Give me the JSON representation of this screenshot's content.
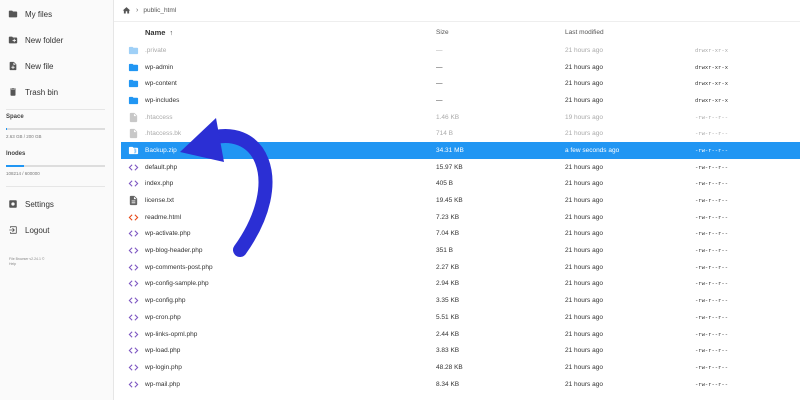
{
  "sidebar": {
    "items": [
      {
        "label": "My files",
        "icon": "folder-icon"
      },
      {
        "label": "New folder",
        "icon": "new-folder-icon"
      },
      {
        "label": "New file",
        "icon": "new-file-icon"
      },
      {
        "label": "Trash bin",
        "icon": "trash-icon"
      }
    ],
    "space_label": "Space",
    "space_text": "2.63 GB / 200 GB",
    "space_fraction": 0.013,
    "inodes_label": "Inodes",
    "inodes_text": "108214 / 600000",
    "inodes_fraction": 0.18,
    "bottom_items": [
      {
        "label": "Settings",
        "icon": "settings-icon"
      },
      {
        "label": "Logout",
        "icon": "logout-icon"
      }
    ],
    "credits_line1": "File Browser v2.24.1 ©",
    "credits_line2": "Help"
  },
  "breadcrumb": {
    "folder": "public_html"
  },
  "table": {
    "headers": {
      "name": "Name",
      "size": "Size",
      "modified": "Last modified"
    },
    "rows": [
      {
        "name": ".private",
        "size": "—",
        "modified": "21 hours ago",
        "perm": "drwxr-xr-x",
        "type": "folder",
        "hidden": true
      },
      {
        "name": "wp-admin",
        "size": "—",
        "modified": "21 hours ago",
        "perm": "drwxr-xr-x",
        "type": "folder"
      },
      {
        "name": "wp-content",
        "size": "—",
        "modified": "21 hours ago",
        "perm": "drwxr-xr-x",
        "type": "folder"
      },
      {
        "name": "wp-includes",
        "size": "—",
        "modified": "21 hours ago",
        "perm": "drwxr-xr-x",
        "type": "folder"
      },
      {
        "name": ".htaccess",
        "size": "1.46 KB",
        "modified": "19 hours ago",
        "perm": "-rw-r--r--",
        "type": "file",
        "hidden": true
      },
      {
        "name": ".htaccess.bk",
        "size": "714 B",
        "modified": "21 hours ago",
        "perm": "-rw-r--r--",
        "type": "file",
        "hidden": true
      },
      {
        "name": "Backup.zip",
        "size": "34.31 MB",
        "modified": "a few seconds ago",
        "perm": "-rw-r--r--",
        "type": "zip",
        "selected": true
      },
      {
        "name": "default.php",
        "size": "15.97 KB",
        "modified": "21 hours ago",
        "perm": "-rw-r--r--",
        "type": "code"
      },
      {
        "name": "index.php",
        "size": "405 B",
        "modified": "21 hours ago",
        "perm": "-rw-r--r--",
        "type": "code"
      },
      {
        "name": "license.txt",
        "size": "19.45 KB",
        "modified": "21 hours ago",
        "perm": "-rw-r--r--",
        "type": "text"
      },
      {
        "name": "readme.html",
        "size": "7.23 KB",
        "modified": "21 hours ago",
        "perm": "-rw-r--r--",
        "type": "html"
      },
      {
        "name": "wp-activate.php",
        "size": "7.04 KB",
        "modified": "21 hours ago",
        "perm": "-rw-r--r--",
        "type": "code"
      },
      {
        "name": "wp-blog-header.php",
        "size": "351 B",
        "modified": "21 hours ago",
        "perm": "-rw-r--r--",
        "type": "code"
      },
      {
        "name": "wp-comments-post.php",
        "size": "2.27 KB",
        "modified": "21 hours ago",
        "perm": "-rw-r--r--",
        "type": "code"
      },
      {
        "name": "wp-config-sample.php",
        "size": "2.94 KB",
        "modified": "21 hours ago",
        "perm": "-rw-r--r--",
        "type": "code"
      },
      {
        "name": "wp-config.php",
        "size": "3.35 KB",
        "modified": "21 hours ago",
        "perm": "-rw-r--r--",
        "type": "code"
      },
      {
        "name": "wp-cron.php",
        "size": "5.51 KB",
        "modified": "21 hours ago",
        "perm": "-rw-r--r--",
        "type": "code"
      },
      {
        "name": "wp-links-opml.php",
        "size": "2.44 KB",
        "modified": "21 hours ago",
        "perm": "-rw-r--r--",
        "type": "code"
      },
      {
        "name": "wp-load.php",
        "size": "3.83 KB",
        "modified": "21 hours ago",
        "perm": "-rw-r--r--",
        "type": "code"
      },
      {
        "name": "wp-login.php",
        "size": "48.28 KB",
        "modified": "21 hours ago",
        "perm": "-rw-r--r--",
        "type": "code"
      },
      {
        "name": "wp-mail.php",
        "size": "8.34 KB",
        "modified": "21 hours ago",
        "perm": "-rw-r--r--",
        "type": "code"
      }
    ]
  },
  "colors": {
    "accent": "#2196f3",
    "folder": "#2196f3",
    "folder_hidden": "#9fd0f7",
    "code": "#7e57c2",
    "html": "#e64a19",
    "annotation_arrow": "#2b2fd4"
  }
}
